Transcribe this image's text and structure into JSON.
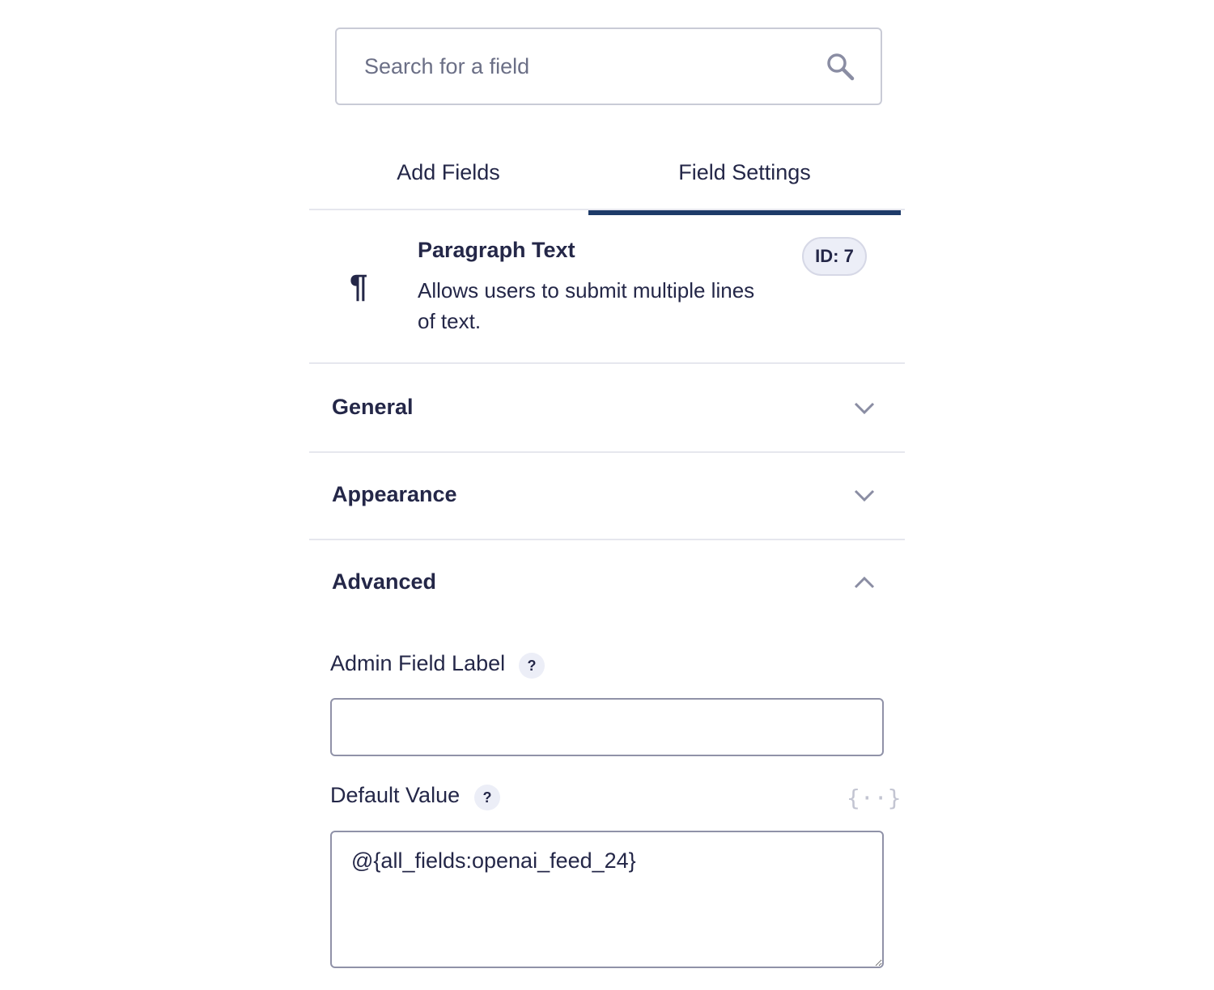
{
  "search": {
    "placeholder": "Search for a field",
    "icon": "search-icon"
  },
  "tabs": [
    {
      "label": "Add Fields",
      "active": false
    },
    {
      "label": "Field Settings",
      "active": true
    }
  ],
  "field": {
    "title": "Paragraph Text",
    "description": "Allows users to submit multiple lines of text.",
    "icon": "pilcrow-icon",
    "id_label": "ID: 7"
  },
  "sections": [
    {
      "label": "General",
      "expanded": false
    },
    {
      "label": "Appearance",
      "expanded": false
    },
    {
      "label": "Advanced",
      "expanded": true
    }
  ],
  "advanced": {
    "admin_label": {
      "label": "Admin Field Label",
      "help": "?",
      "value": ""
    },
    "default_value": {
      "label": "Default Value",
      "help": "?",
      "merge_tag_icon": "{··}",
      "value": "@{all_fields:openai_feed_24}"
    }
  },
  "colors": {
    "text": "#242748",
    "accent": "#1e3b69",
    "border": "#9092a8",
    "badge_bg": "#eceef7"
  }
}
